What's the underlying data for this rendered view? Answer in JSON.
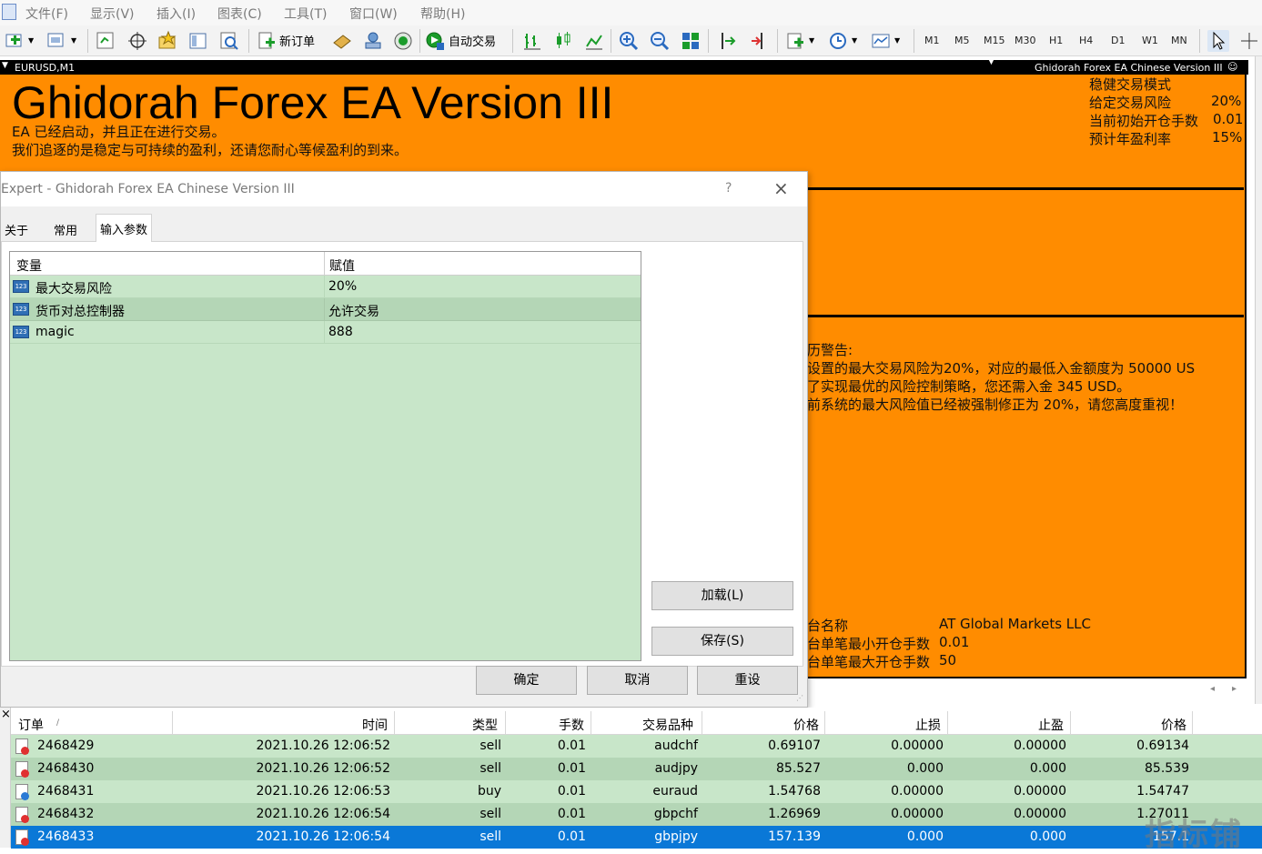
{
  "menu": [
    "文件(F)",
    "显示(V)",
    "插入(I)",
    "图表(C)",
    "工具(T)",
    "窗口(W)",
    "帮助(H)"
  ],
  "toolbar": {
    "new_order": "新订单",
    "auto_trade": "自动交易",
    "timeframes": [
      "M1",
      "M5",
      "M15",
      "M30",
      "H1",
      "H4",
      "D1",
      "W1",
      "MN"
    ]
  },
  "chart": {
    "symbol_label": "EURUSD,M1",
    "ea_label": "Ghidorah Forex EA Chinese Version III",
    "big_title": "Ghidorah Forex EA Version III",
    "status_line1": "EA 已经启动，并且正在进行交易。",
    "status_line2": "我们追逐的是稳定与可持续的盈利，还请您耐心等候盈利的到来。",
    "mode": "稳健交易模式",
    "risk_label": "给定交易风险",
    "risk_value": "20%",
    "lots_label": "当前初始开仓手数",
    "lots_value": "0.01",
    "yield_label": "预计年盈利率",
    "yield_value": "15%",
    "warning_title": "历警告:",
    "warning_1": "设置的最大交易风险为20%，对应的最低入金额度为 50000 US",
    "warning_2": "了实现最优的风险控制策略，您还需入金 345 USD。",
    "warning_3": "前系统的最大风险值已经被强制修正为 20%，请您高度重视！",
    "platform_label": "台名称",
    "platform_value": "AT Global Markets LLC",
    "min_lot_label": "台单笔最小开仓手数",
    "min_lot_value": "0.01",
    "max_lot_label": "台单笔最大开仓手数",
    "max_lot_value": "50"
  },
  "dialog": {
    "title": "Expert - Ghidorah Forex EA Chinese Version III",
    "help": "?",
    "tabs": [
      "关于",
      "常用",
      "输入参数"
    ],
    "col_variable": "变量",
    "col_value": "赋值",
    "params": [
      {
        "name": "最大交易风险",
        "value": "20%"
      },
      {
        "name": "货币对总控制器",
        "value": "允许交易"
      },
      {
        "name": "magic",
        "value": "888"
      }
    ],
    "load": "加载(L)",
    "save": "保存(S)",
    "ok": "确定",
    "cancel": "取消",
    "reset": "重设"
  },
  "terminal": {
    "headers": {
      "order": "订单",
      "time": "时间",
      "type": "类型",
      "lots": "手数",
      "symbol": "交易品种",
      "price": "价格",
      "sl": "止损",
      "tp": "止盈",
      "price2": "价格"
    },
    "rows": [
      {
        "order": "2468429",
        "time": "2021.10.26 12:06:52",
        "type": "sell",
        "lots": "0.01",
        "symbol": "audchf",
        "price": "0.69107",
        "sl": "0.00000",
        "tp": "0.00000",
        "price2": "0.69134"
      },
      {
        "order": "2468430",
        "time": "2021.10.26 12:06:52",
        "type": "sell",
        "lots": "0.01",
        "symbol": "audjpy",
        "price": "85.527",
        "sl": "0.000",
        "tp": "0.000",
        "price2": "85.539"
      },
      {
        "order": "2468431",
        "time": "2021.10.26 12:06:53",
        "type": "buy",
        "lots": "0.01",
        "symbol": "euraud",
        "price": "1.54768",
        "sl": "0.00000",
        "tp": "0.00000",
        "price2": "1.54747"
      },
      {
        "order": "2468432",
        "time": "2021.10.26 12:06:54",
        "type": "sell",
        "lots": "0.01",
        "symbol": "gbpchf",
        "price": "1.26969",
        "sl": "0.00000",
        "tp": "0.00000",
        "price2": "1.27011"
      },
      {
        "order": "2468433",
        "time": "2021.10.26 12:06:54",
        "type": "sell",
        "lots": "0.01",
        "symbol": "gbpjpy",
        "price": "157.139",
        "sl": "0.000",
        "tp": "0.000",
        "price2": "157.1"
      }
    ]
  },
  "watermark": "指标铺",
  "colors": {
    "chart_bg": "#ff8c00",
    "grid_bg": "#c8e6c9",
    "selected_row": "#0a78d7"
  }
}
